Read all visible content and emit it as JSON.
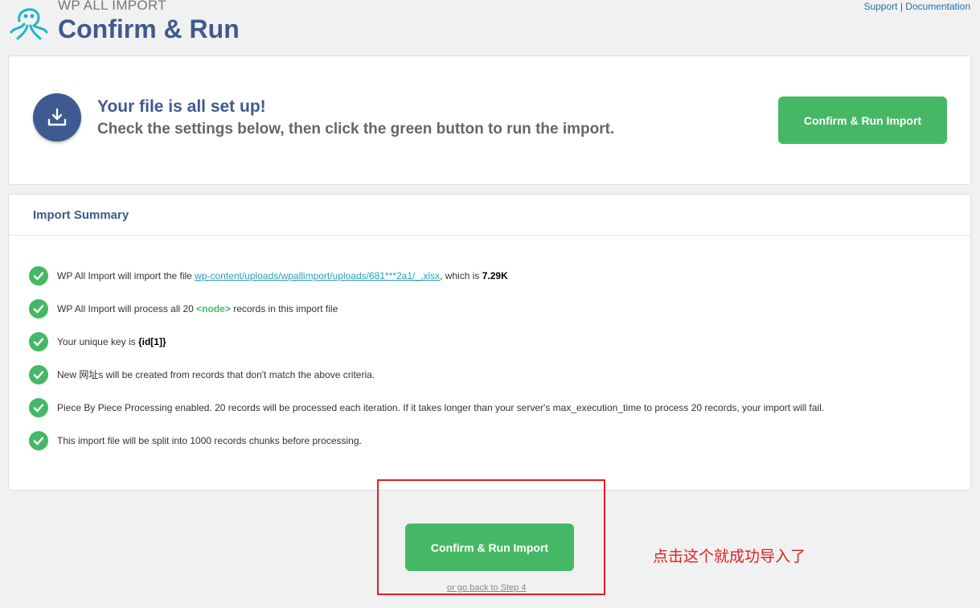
{
  "header": {
    "brand_small": "WP ALL IMPORT",
    "title": "Confirm & Run",
    "support_link": "Support",
    "separator": " | ",
    "docs_link": "Documentation"
  },
  "setup": {
    "title": "Your file is all set up!",
    "subtitle": "Check the settings below, then click the green button to run the import.",
    "button_label": "Confirm & Run Import",
    "icon": "download-icon"
  },
  "summary": {
    "title": "Import Summary",
    "items": [
      {
        "pre": "WP All Import will import the file ",
        "link": "wp-content/uploads/wpallimport/uploads/681***2a1/_.xlsx",
        "mid": ", which is ",
        "bold": "7.29K"
      },
      {
        "pre": "WP All Import will process all 20 ",
        "node": "<node>",
        "post": " records in this import file"
      },
      {
        "pre": "Your unique key is ",
        "bold": "{id[1]}"
      },
      {
        "text": "New 网址s will be created from records that don't match the above criteria."
      },
      {
        "text": "Piece By Piece Processing enabled. 20 records will be processed each iteration. If it takes longer than your server's max_execution_time to process 20 records, your import will fail."
      },
      {
        "text": "This import file will be split into 1000 records chunks before processing."
      }
    ]
  },
  "footer": {
    "button_label": "Confirm & Run Import",
    "back_link": "or go back to Step 4"
  },
  "annotation": {
    "text": "点击这个就成功导入了"
  },
  "colors": {
    "brand_blue": "#3f5a90",
    "green": "#46b865",
    "annotation_red": "#e02020"
  }
}
